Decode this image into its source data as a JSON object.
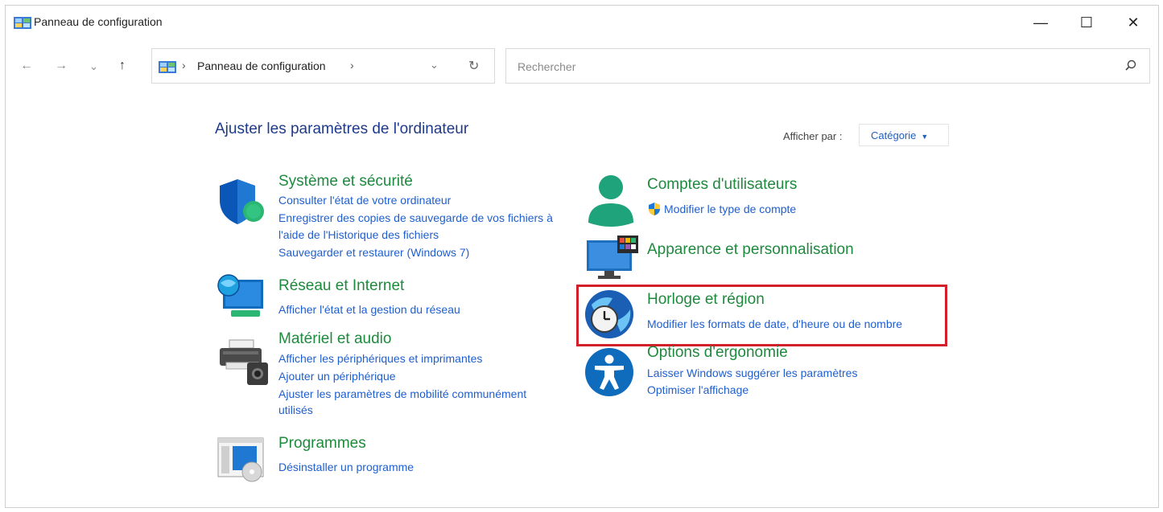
{
  "window": {
    "title": "Panneau de configuration",
    "controls": {
      "minimize": "—",
      "maximize": "☐",
      "close": "✕"
    }
  },
  "nav": {
    "back": "←",
    "forward": "→",
    "recent": "⌄",
    "up": "↑"
  },
  "address": {
    "icon": "control-panel-icon",
    "separator": "›",
    "crumb": "Panneau de configuration",
    "dropdown": "⌄",
    "refresh": "↻"
  },
  "search": {
    "placeholder": "Rechercher",
    "icon": "search-icon"
  },
  "main": {
    "heading": "Ajuster les paramètres de l'ordinateur",
    "view_by_label": "Afficher par :",
    "view_by_value": "Catégorie",
    "view_by_caret": "▼"
  },
  "categories": {
    "system": {
      "title": "Système et sécurité",
      "icon": "shield-icon",
      "links": [
        "Consulter l'état de votre ordinateur",
        "Enregistrer des copies de sauvegarde de vos fichiers à",
        "l'aide de l'Historique des fichiers",
        "Sauvegarder et restaurer (Windows 7)"
      ]
    },
    "network": {
      "title": "Réseau et Internet",
      "icon": "network-globe-icon",
      "links": [
        "Afficher l'état et la gestion du réseau"
      ]
    },
    "hardware": {
      "title": "Matériel et audio",
      "icon": "printer-icon",
      "links": [
        "Afficher les périphériques et imprimantes",
        "Ajouter un périphérique",
        "Ajuster les paramètres de mobilité communément",
        "utilisés"
      ]
    },
    "programs": {
      "title": "Programmes",
      "icon": "programs-icon",
      "links": [
        "Désinstaller un programme"
      ]
    },
    "accounts": {
      "title": "Comptes d'utilisateurs",
      "icon": "user-icon",
      "links": [
        "Modifier le type de compte"
      ],
      "link_icon": "uac-shield-icon"
    },
    "appearance": {
      "title": "Apparence et personnalisation",
      "icon": "monitor-palette-icon",
      "links": []
    },
    "clock": {
      "title": "Horloge et région",
      "icon": "globe-clock-icon",
      "links": [
        "Modifier les formats de date, d'heure ou de nombre"
      ],
      "highlighted": true
    },
    "ease": {
      "title": "Options d'ergonomie",
      "icon": "accessibility-icon",
      "links": [
        "Laisser Windows suggérer les paramètres",
        "Optimiser l'affichage"
      ]
    }
  },
  "colors": {
    "category_title": "#1e8a3d",
    "link": "#1e5fcf",
    "heading": "#1e3a8a",
    "highlight_border": "#d21f2a"
  }
}
